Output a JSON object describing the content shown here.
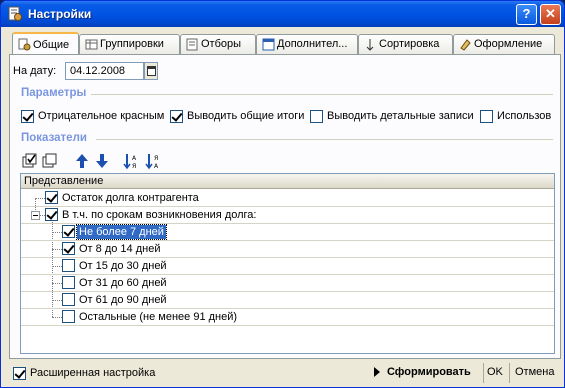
{
  "window": {
    "title": "Настройки",
    "help_label": "?",
    "close_label": "✕"
  },
  "tabs": [
    {
      "label": "Общие",
      "icon": "gear-doc-icon",
      "active": true
    },
    {
      "label": "Группировки",
      "icon": "grid-icon"
    },
    {
      "label": "Отборы",
      "icon": "filter-icon"
    },
    {
      "label": "Дополнител...",
      "icon": "table-icon"
    },
    {
      "label": "Сортировка",
      "icon": "sort-icon"
    },
    {
      "label": "Оформление",
      "icon": "palette-icon"
    }
  ],
  "date": {
    "label": "На дату:",
    "value": "04.12.2008"
  },
  "parameters": {
    "title": "Параметры",
    "items": [
      {
        "label": "Отрицательное красным",
        "checked": true
      },
      {
        "label": "Выводить общие итоги",
        "checked": true
      },
      {
        "label": "Выводить детальные записи",
        "checked": false
      },
      {
        "label": "Использов",
        "checked": false
      }
    ]
  },
  "indicators": {
    "title": "Показатели",
    "column_header": "Представление",
    "rows": [
      {
        "label": "Остаток долга контрагента",
        "checked": true,
        "level": 0
      },
      {
        "label": "В т.ч. по срокам возникновения долга:",
        "checked": true,
        "level": 0,
        "expanded": true
      },
      {
        "label": "Не более 7 дней",
        "checked": true,
        "level": 1,
        "selected": true
      },
      {
        "label": "От 8 до 14 дней",
        "checked": true,
        "level": 1
      },
      {
        "label": "От 15 до 30 дней",
        "checked": false,
        "level": 1
      },
      {
        "label": "От 31 до 60 дней",
        "checked": false,
        "level": 1
      },
      {
        "label": "От 61 до 90 дней",
        "checked": false,
        "level": 1
      },
      {
        "label": "Остальные (не менее 91 дней)",
        "checked": false,
        "level": 1
      }
    ]
  },
  "footer": {
    "advanced_label": "Расширенная настройка",
    "advanced_checked": true,
    "generate_label": "Сформировать",
    "ok_label": "OK",
    "cancel_label": "Отмена"
  },
  "colors": {
    "title_bar": "#0054e3",
    "section_title": "#7a96df",
    "selection": "#316ac5"
  }
}
